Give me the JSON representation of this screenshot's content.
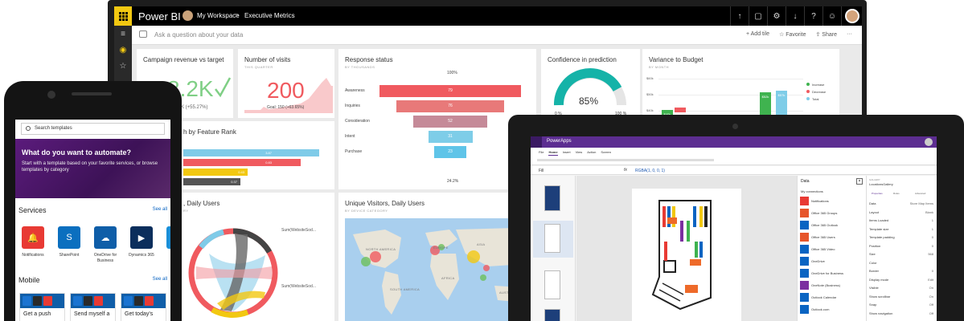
{
  "powerbi": {
    "brand": "Power BI",
    "workspace": "My Workspace",
    "separator": ">",
    "report": "Executive Metrics",
    "qa_placeholder": "Ask a question about your data",
    "actions": {
      "add_tile": "+ Add tile",
      "favorite": "☆ Favorite",
      "share": "⇪ Share",
      "more": "···"
    },
    "tiles": {
      "campaign": {
        "title": "Campaign revenue vs target",
        "value": "8.2K",
        "goal": "K (+55.27%)"
      },
      "visits": {
        "title": "Number of visits",
        "sub": "THIS QUARTER",
        "value": "200",
        "goal": "Goal: 150 (+63.65%)"
      },
      "response": {
        "title": "Response status",
        "sub": "BY THOUSANDS",
        "top_pct": "100%",
        "bottom_pct": "24.2%"
      },
      "confidence": {
        "title": "Confidence in prediction",
        "value": "85%",
        "min": "0 %",
        "max": "100 %"
      },
      "variance": {
        "title": "Variance to Budget",
        "sub": "BY MONTH"
      },
      "feature": {
        "title": "h by Feature Rank"
      },
      "daily": {
        "title": ", Daily Users",
        "sub": "RY"
      },
      "unique": {
        "title": "Unique Visitors, Daily Users",
        "sub": "BY DEVICE CATEGORY"
      }
    },
    "funnel": [
      {
        "label": "Awareness",
        "value": "79",
        "color": "#f05a5f",
        "frac": 1.0
      },
      {
        "label": "Inquiries",
        "value": "76",
        "color": "#e87979",
        "frac": 0.76
      },
      {
        "label": "Consideration",
        "value": "52",
        "color": "#c58a98",
        "frac": 0.52
      },
      {
        "label": "Intent",
        "value": "31",
        "color": "#7ecde8",
        "frac": 0.31
      },
      {
        "label": "Purchase",
        "value": "23",
        "color": "#5fc4e8",
        "frac": 0.23
      }
    ],
    "feature_bars": [
      {
        "value": "3.87",
        "color": "#7fcbe8",
        "frac": 0.95
      },
      {
        "value": "0.83",
        "color": "#f05a5f",
        "frac": 0.82
      },
      {
        "value": "0.43",
        "color": "#f2c811",
        "frac": 0.45
      },
      {
        "value": "0.37",
        "color": "#555555",
        "frac": 0.4
      }
    ],
    "variance": {
      "y_labels": [
        "$60k",
        "$50k",
        "$40k"
      ],
      "legend": [
        {
          "label": "Increase",
          "color": "#3fb34f"
        },
        {
          "label": "Decrease",
          "color": "#f05a5f"
        },
        {
          "label": "Total",
          "color": "#7ecde8"
        }
      ],
      "bars": [
        {
          "label": "$40k",
          "color": "#3fb34f"
        },
        {
          "label": "",
          "color": "#f05a5f"
        },
        {
          "label": "$52k",
          "color": "#3fb34f"
        },
        {
          "label": "$57k",
          "color": "#7ecde8"
        }
      ]
    },
    "chord_labels": [
      "Sum(WebsiteSod...",
      "Sum(WebsiteSod..."
    ],
    "map_labels": [
      "NORTH AMERICA",
      "EUROPE",
      "ASIA",
      "AFRICA",
      "SOUTH AMERICA",
      "AUSTRALIA"
    ]
  },
  "phone": {
    "search_placeholder": "Search templates",
    "hero_title": "What do you want to automate?",
    "hero_desc": "Start with a template based on your favorite services, or browse templates by category",
    "services_heading": "Services",
    "mobile_heading": "Mobile",
    "see_all": "See all",
    "services": [
      {
        "label": "Notifications",
        "color": "#e83a34",
        "icon": "bell-icon"
      },
      {
        "label": "SharePoint",
        "color": "#0b6fbf",
        "icon": "sharepoint-icon"
      },
      {
        "label": "OneDrive for Business",
        "color": "#0f5ea8",
        "icon": "cloud-icon"
      },
      {
        "label": "Dynamics 365",
        "color": "#0b2e5c",
        "icon": "dynamics-icon"
      },
      {
        "label": "Sa",
        "color": "#1a8fd8",
        "icon": "app-icon"
      }
    ],
    "cards": [
      "Get a push",
      "Send myself a",
      "Get today's"
    ]
  },
  "powerapps": {
    "brand": "PowerApps",
    "menu": [
      "File",
      "Home",
      "Insert",
      "View",
      "Action",
      "Screen"
    ],
    "formula_prop": "Fill",
    "formula_fx": "fx",
    "formula_value": "RGBA(1, 0, 0, 1)",
    "data_title": "Data",
    "connections_label": "My connections",
    "connections": [
      {
        "label": "Notifications",
        "color": "#e83a34"
      },
      {
        "label": "Office 365 Groups",
        "color": "#e6562b"
      },
      {
        "label": "Office 365 Outlook",
        "color": "#0a64c2"
      },
      {
        "label": "Office 365 Users",
        "color": "#e6562b"
      },
      {
        "label": "Office 365 Video",
        "color": "#0a64c2"
      },
      {
        "label": "OneDrive",
        "color": "#0a64c2"
      },
      {
        "label": "OneDrive for Business",
        "color": "#0a64c2"
      },
      {
        "label": "OneNote (Business)",
        "color": "#7b2fa0"
      },
      {
        "label": "Outlook Calendar",
        "color": "#0a64c2"
      },
      {
        "label": "Outlook.com",
        "color": "#0a64c2"
      }
    ],
    "props_header": "GALLERY",
    "props_name": "LocationsGallery",
    "props_tabs": [
      "Properties",
      "Rules",
      "Advanced"
    ],
    "props": [
      {
        "label": "Data",
        "value": "Store Map Items"
      },
      {
        "label": "Layout",
        "value": "Blank"
      },
      {
        "label": "Items Loaded",
        "value": "1"
      },
      {
        "label": "Template size",
        "value": "1"
      },
      {
        "label": "Template padding",
        "value": "0"
      },
      {
        "label": "Position",
        "value": "0"
      },
      {
        "label": "Size",
        "value": "568"
      },
      {
        "label": "Color",
        "value": ""
      },
      {
        "label": "Border",
        "value": "0"
      },
      {
        "label": "Display mode",
        "value": "Edit"
      },
      {
        "label": "Visible",
        "value": "On"
      },
      {
        "label": "Show scrollbar",
        "value": "On"
      },
      {
        "label": "Snap",
        "value": "Off"
      },
      {
        "label": "Show navigation",
        "value": "Off"
      }
    ]
  }
}
